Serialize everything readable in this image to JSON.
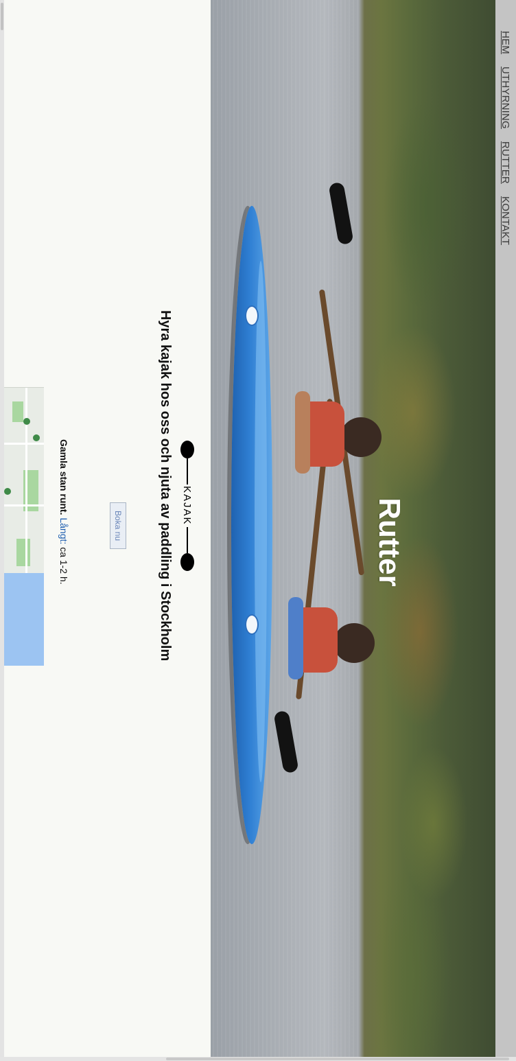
{
  "nav": {
    "items": [
      {
        "label": "HEM"
      },
      {
        "label": "UTHYRNING"
      },
      {
        "label": "RUTTER"
      },
      {
        "label": "KONTAKT"
      }
    ]
  },
  "hero": {
    "title": "Rutter"
  },
  "main": {
    "tagline": "Hyra kajak hos oss och njuta av paddling i Stockholm",
    "logo_text": "KAJAK",
    "book_button": "Boka nu",
    "route": {
      "name": "Gamla stan runt.",
      "length_label": "Långt:",
      "length_value": "ca 1-2 h."
    }
  },
  "colors": {
    "navbar": "#c4c4c4",
    "background": "#f8f9f5",
    "kayak": "#2f7fd3",
    "vest": "#c8513c"
  },
  "icons": {
    "logo": "kayak-paddle-icon",
    "map_pin": "map-pin-icon"
  }
}
